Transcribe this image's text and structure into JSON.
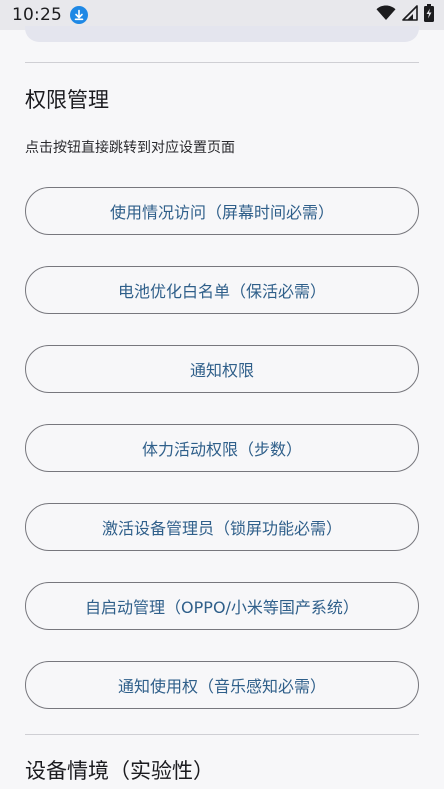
{
  "status_bar": {
    "time": "10:25",
    "icons": [
      "download-icon",
      "wifi-icon",
      "signal-icon",
      "battery-charging-icon"
    ],
    "colors": {
      "download_badge": "#1e88e5"
    }
  },
  "permissions_section": {
    "title": "权限管理",
    "description": "点击按钮直接跳转到对应设置页面",
    "buttons": [
      {
        "label": "使用情况访问（屏幕时间必需）"
      },
      {
        "label": "电池优化白名单（保活必需）"
      },
      {
        "label": "通知权限"
      },
      {
        "label": "体力活动权限（步数）"
      },
      {
        "label": "激活设备管理员（锁屏功能必需）"
      },
      {
        "label": "自启动管理（OPPO/小米等国产系统）"
      },
      {
        "label": "通知使用权（音乐感知必需）"
      }
    ]
  },
  "device_section": {
    "title": "设备情境（实验性）"
  },
  "colors": {
    "button_text": "#2f5f8a",
    "button_border": "#77777d",
    "background": "#f7f7f9"
  }
}
